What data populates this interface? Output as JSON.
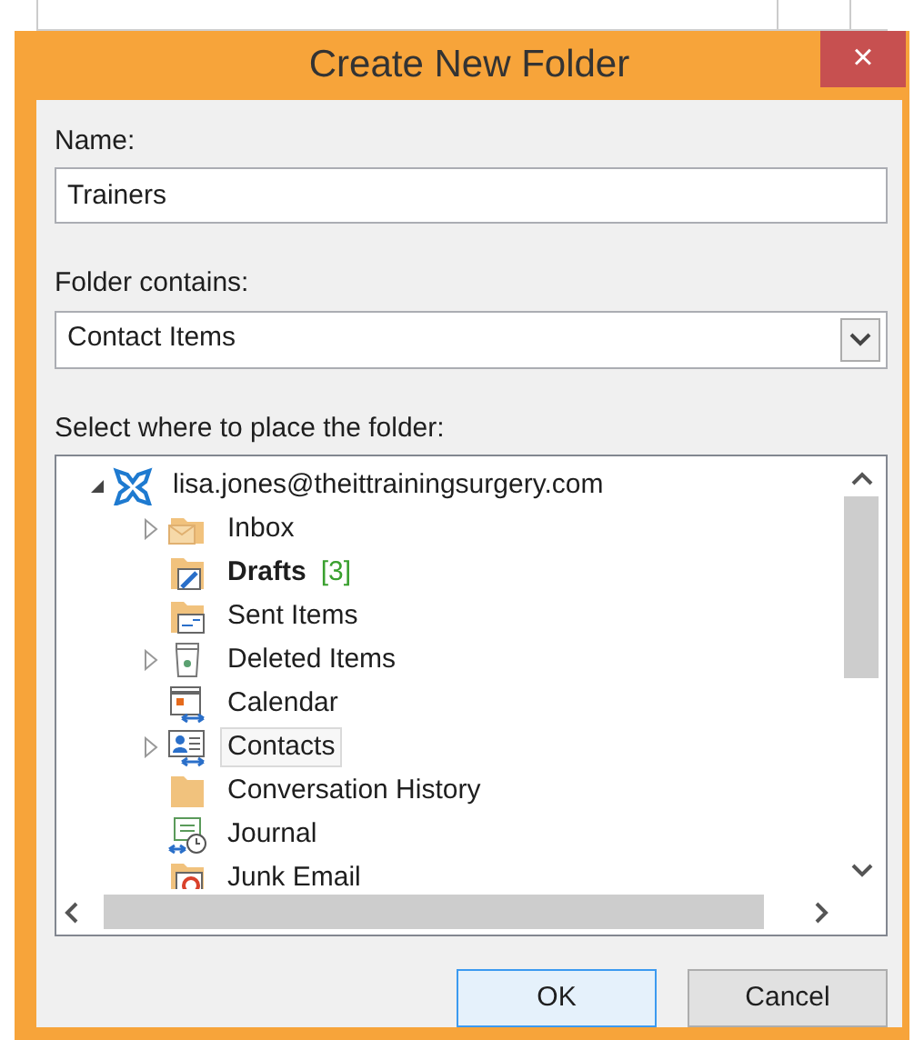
{
  "window": {
    "title": "Create New Folder",
    "close": "×"
  },
  "name_field": {
    "label": "Name:",
    "value": "Trainers"
  },
  "contains_field": {
    "label": "Folder contains:",
    "value": "Contact Items"
  },
  "tree": {
    "label": "Select where to place the folder:",
    "items": [
      {
        "label": "lisa.jones@theittrainingsurgery.com",
        "kind": "account",
        "expanded": true,
        "selected": false,
        "children": [
          {
            "label": "Inbox",
            "kind": "inbox",
            "expanded": false,
            "selected": false
          },
          {
            "label": "Drafts",
            "kind": "drafts",
            "bold": true,
            "count": "[3]",
            "selected": false
          },
          {
            "label": "Sent Items",
            "kind": "sent",
            "selected": false
          },
          {
            "label": "Deleted Items",
            "kind": "deleted",
            "expanded": false,
            "selected": false
          },
          {
            "label": "Calendar",
            "kind": "calendar",
            "selected": false
          },
          {
            "label": "Contacts",
            "kind": "contacts",
            "expanded": false,
            "selected": true
          },
          {
            "label": "Conversation History",
            "kind": "folder",
            "selected": false
          },
          {
            "label": "Journal",
            "kind": "journal",
            "selected": false
          },
          {
            "label": "Junk Email",
            "kind": "junk",
            "selected": false
          }
        ]
      }
    ]
  },
  "buttons": [
    {
      "label": "OK",
      "default": true
    },
    {
      "label": "Cancel",
      "default": false
    }
  ]
}
